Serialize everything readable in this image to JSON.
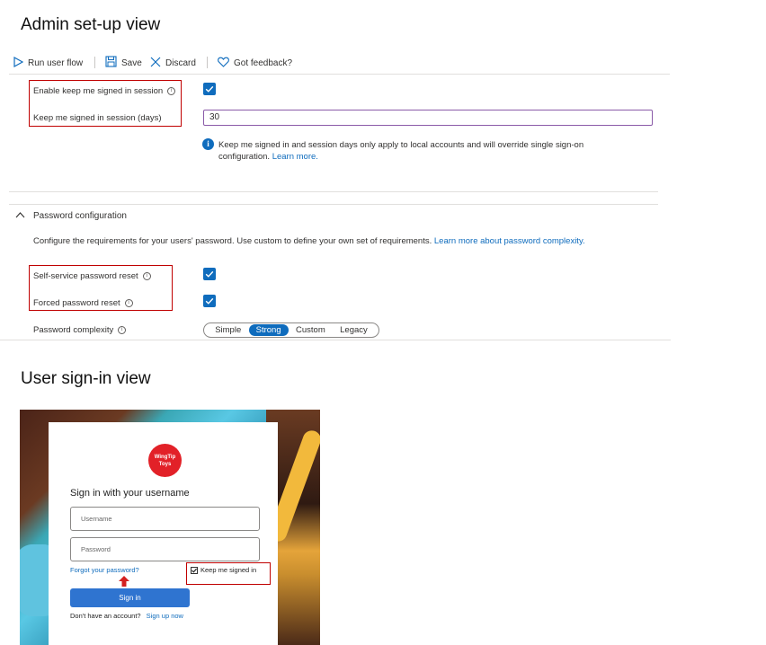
{
  "admin_title": "Admin set-up view",
  "toolbar": {
    "run_user_flow": "Run user flow",
    "save": "Save",
    "discard": "Discard",
    "feedback": "Got feedback?"
  },
  "session": {
    "enable_label": "Enable keep me signed in session",
    "enable_checked": true,
    "days_label": "Keep me signed in session (days)",
    "days_value": "30",
    "note_text": "Keep me signed in and session days only apply to local accounts and will override single sign-on configuration.",
    "note_link": "Learn more."
  },
  "password": {
    "section_header": "Password configuration",
    "description": "Configure the requirements for your users' password. Use custom to define your own set of requirements.",
    "description_link": "Learn more about password complexity.",
    "self_service_label": "Self-service password reset",
    "self_service_checked": true,
    "forced_label": "Forced password reset",
    "forced_checked": true,
    "complexity_label": "Password complexity",
    "complexity_options": [
      "Simple",
      "Strong",
      "Custom",
      "Legacy"
    ],
    "complexity_selected": "Strong"
  },
  "user_title": "User sign-in view",
  "signin": {
    "logo_text_line1": "WingTip",
    "logo_text_line2": "Toys",
    "heading": "Sign in with your username",
    "username_placeholder": "Username",
    "password_placeholder": "Password",
    "forgot_link": "Forgot your password?",
    "keep_signed_in": "Keep me signed in",
    "keep_signed_in_checked": true,
    "sign_in_button": "Sign in",
    "no_account": "Don't have an account?",
    "sign_up": "Sign up now"
  },
  "colors": {
    "accent": "#0f6cbd",
    "highlight_box": "#c00000",
    "signin_button": "#2f74d0",
    "logo": "#e22128"
  }
}
